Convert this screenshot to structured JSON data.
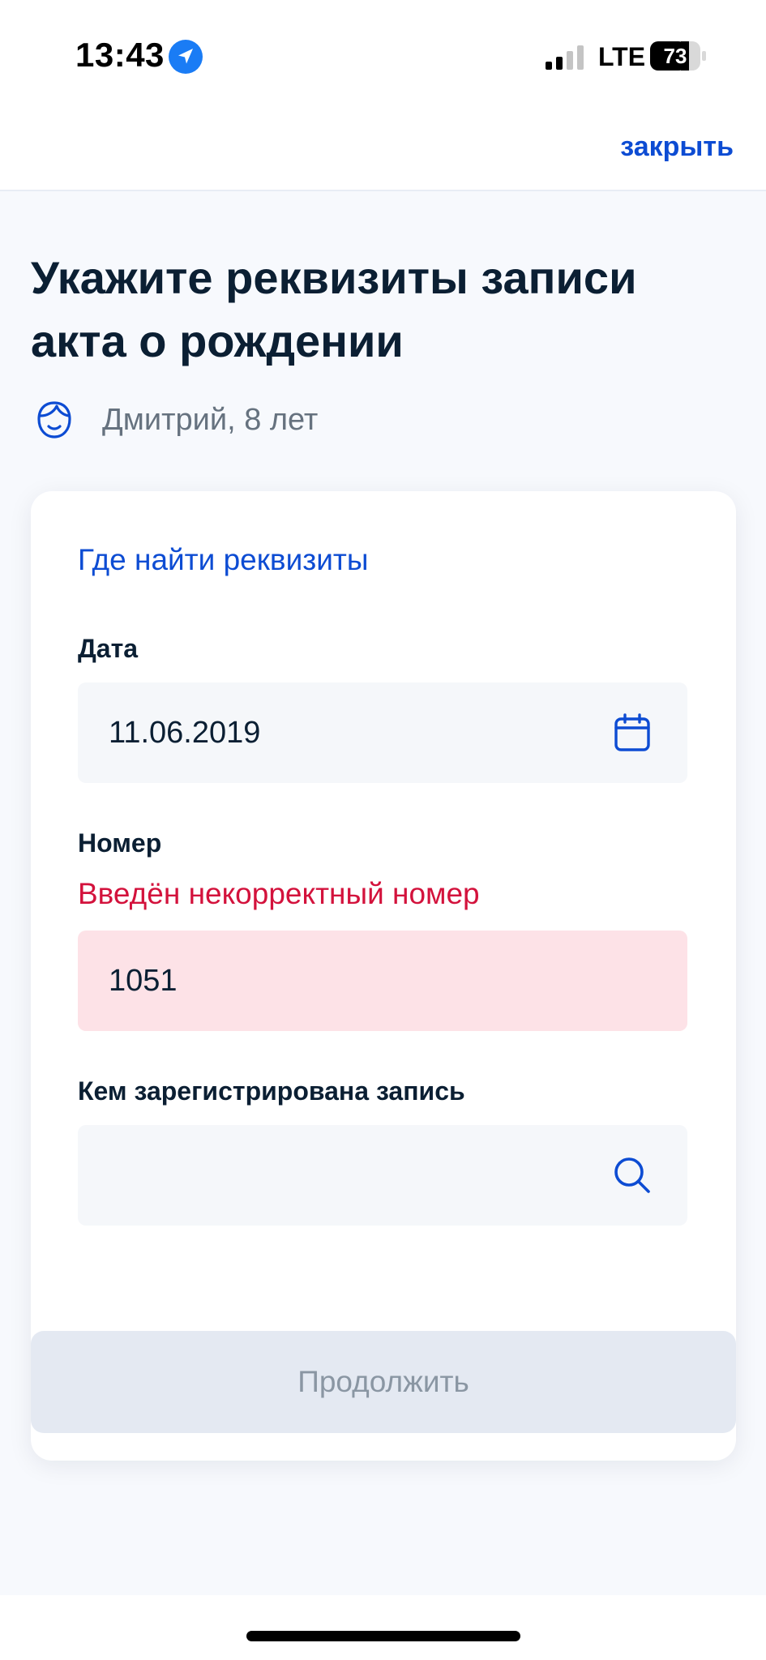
{
  "status_bar": {
    "time": "13:43",
    "network": "LTE",
    "battery": "73"
  },
  "header": {
    "close_label": "закрыть"
  },
  "page": {
    "title": "Укажите реквизиты записи акта о рождении",
    "person": "Дмитрий, 8 лет"
  },
  "form": {
    "help_link": "Где найти реквизиты",
    "date": {
      "label": "Дата",
      "value": "11.06.2019",
      "icon": "calendar-icon"
    },
    "number": {
      "label": "Номер",
      "error": "Введён некорректный номер",
      "value": "1051"
    },
    "registrar": {
      "label": "Кем зарегистрирована запись",
      "value": "",
      "icon": "search-icon"
    }
  },
  "actions": {
    "continue_label": "Продолжить"
  },
  "colors": {
    "accent": "#0d4cd3",
    "error": "#d3123c",
    "error_bg": "#fde2e7",
    "disabled_bg": "#e4e9f2",
    "text": "#0b1f33",
    "muted": "#66727f"
  }
}
